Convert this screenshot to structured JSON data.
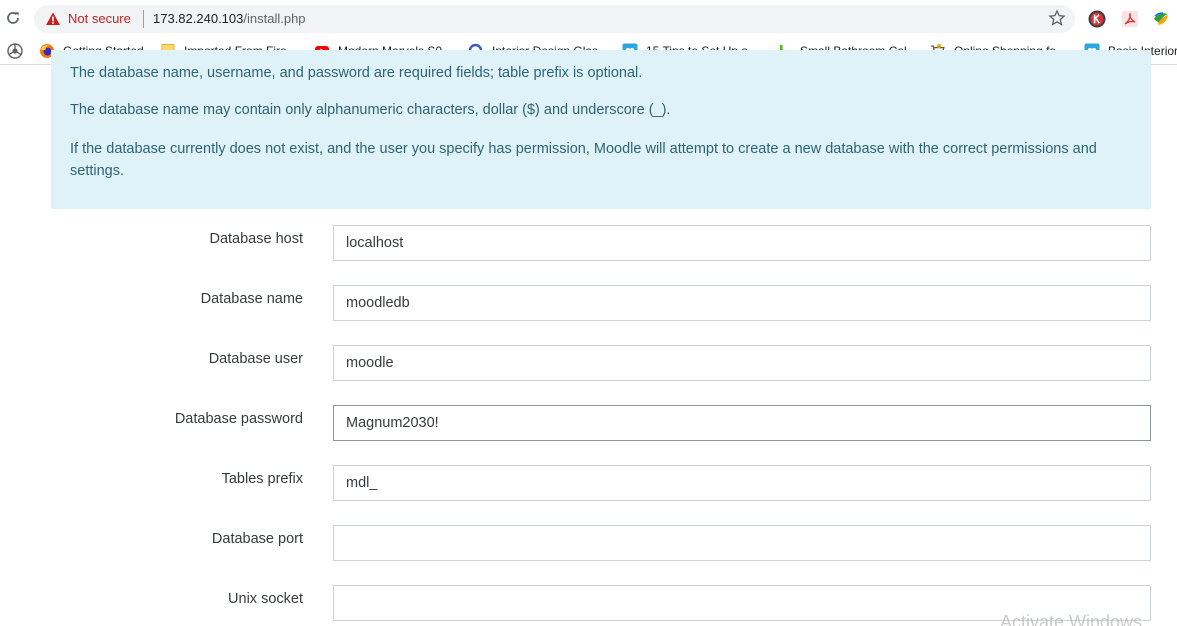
{
  "browser": {
    "security_label": "Not secure",
    "url_host": "173.82.240.103",
    "url_path": "/install.php",
    "bookmarks": [
      {
        "label": "Getting Started",
        "icon": "firefox-icon"
      },
      {
        "label": "Imported From Fire...",
        "icon": "folder-icon"
      },
      {
        "label": "Modern Marvels S0...",
        "icon": "youtube-icon"
      },
      {
        "label": "Interior Design Glos...",
        "icon": "q-logo-icon"
      },
      {
        "label": "15 Tips to Set Up a...",
        "icon": "heart-bookmark-icon"
      },
      {
        "label": "Small Bathroom Col...",
        "icon": "houzz-icon"
      },
      {
        "label": "Online Shopping fo...",
        "icon": "cart-icon"
      },
      {
        "label": "Basic Interior",
        "icon": "heart-bookmark-icon"
      }
    ],
    "colors": {
      "warning": "#c5221f",
      "omnibox": "#f1f3f4"
    }
  },
  "notice": {
    "line1": "The database name, username, and password are required fields; table prefix is optional.",
    "line2": "The database name may contain only alphanumeric characters, dollar ($) and underscore (_).",
    "line3": "If the database currently does not exist, and the user you specify has permission, Moodle will attempt to create a new database with the correct permissions and settings."
  },
  "form": {
    "fields": [
      {
        "label": "Database host",
        "value": "localhost"
      },
      {
        "label": "Database name",
        "value": "moodledb"
      },
      {
        "label": "Database user",
        "value": "moodle"
      },
      {
        "label": "Database password",
        "value": "Magnum2030!"
      },
      {
        "label": "Tables prefix",
        "value": "mdl_"
      },
      {
        "label": "Database port",
        "value": ""
      },
      {
        "label": "Unix socket",
        "value": ""
      }
    ]
  },
  "watermark": "Activate Windows"
}
